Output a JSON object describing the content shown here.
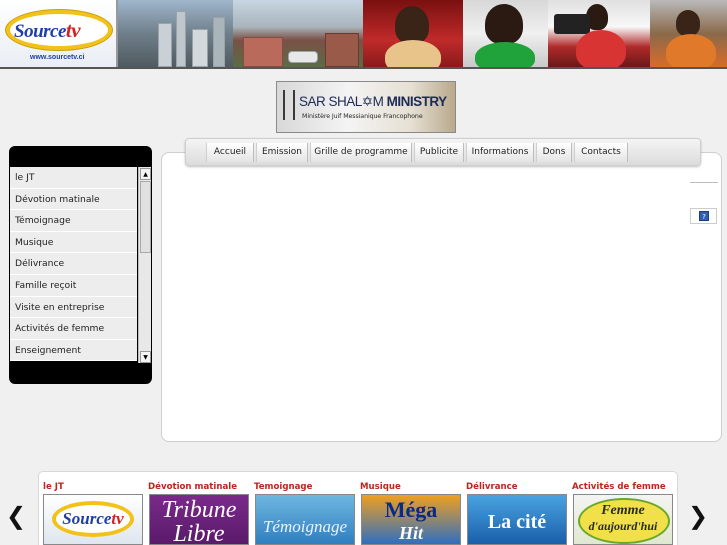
{
  "banner": {
    "logo_text": "Source",
    "logo_tv": "tv",
    "logo_url": "www.sourcetv.ci"
  },
  "sponsor": {
    "title_a": "SAR SHAL",
    "title_b": "M",
    "title_c": " MINISTRY",
    "subtitle": "Ministère Juif Messianique Francophone"
  },
  "left_menu": {
    "items": [
      {
        "label": "le JT"
      },
      {
        "label": "Dévotion matinale"
      },
      {
        "label": "Témoignage"
      },
      {
        "label": "Musique"
      },
      {
        "label": "Délivrance"
      },
      {
        "label": "Famille reçoit"
      },
      {
        "label": "Visite en entreprise"
      },
      {
        "label": "Activités de femme"
      },
      {
        "label": "Enseignement"
      }
    ]
  },
  "topnav": {
    "items": [
      {
        "label": "Accueil"
      },
      {
        "label": "Emission"
      },
      {
        "label": "Grille de programme"
      },
      {
        "label": "Publicite"
      },
      {
        "label": "Informations"
      },
      {
        "label": "Dons"
      },
      {
        "label": "Contacts"
      }
    ]
  },
  "help": {
    "label": "?"
  },
  "carousel": {
    "prev": "❮",
    "next": "❯",
    "items": [
      {
        "label": "le JT",
        "thumb_text": "Source",
        "thumb_tv": "tv"
      },
      {
        "label": "Dévotion matinale",
        "thumb_text": "Tribune",
        "thumb_text2": "Libre"
      },
      {
        "label": "Temoignage",
        "thumb_text": "Témoignage"
      },
      {
        "label": "Musique",
        "thumb_text": "Méga",
        "thumb_text2": "Hit"
      },
      {
        "label": "Délivrance",
        "thumb_text": "La cité"
      },
      {
        "label": "Activités de femme",
        "thumb_text": "Femme",
        "thumb_text2": "d'aujourd'hui"
      }
    ]
  },
  "colors": {
    "accent_red": "#c0241e",
    "logo_blue": "#1f3fa6",
    "logo_yellow": "#f2c21a",
    "menu_black": "#000000"
  }
}
